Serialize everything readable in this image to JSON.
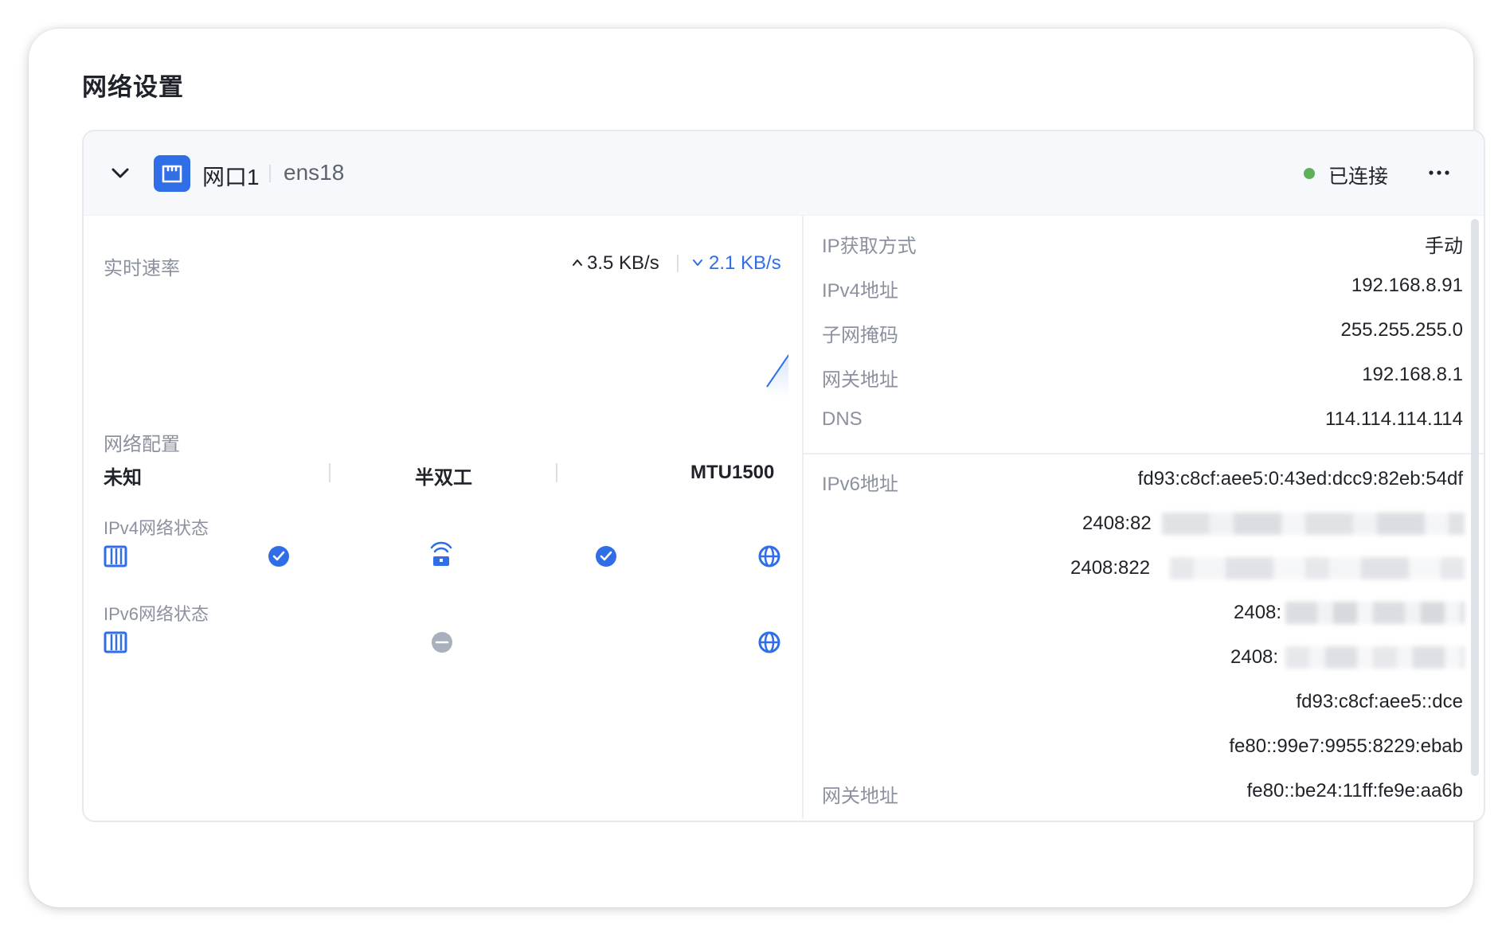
{
  "page": {
    "title": "网络设置"
  },
  "interface": {
    "name": "网口1",
    "device": "ens18",
    "status": "已连接",
    "status_color": "#5fb05a",
    "accent_color": "#2f6ee6"
  },
  "speed": {
    "label": "实时速率",
    "upload": "3.5 KB/s",
    "download": "2.1 KB/s"
  },
  "config": {
    "label": "网络配置",
    "duplex_speed": "未知",
    "duplex": "半双工",
    "mtu": "MTU1500"
  },
  "ipv4_status": {
    "label": "IPv4网络状态",
    "link_ok": true,
    "internet_ok": true
  },
  "ipv6_status": {
    "label": "IPv6网络状态",
    "state": "unknown"
  },
  "details": {
    "ip_method_label": "IP获取方式",
    "ip_method_value": "手动",
    "ipv4_label": "IPv4地址",
    "ipv4_value": "192.168.8.91",
    "mask_label": "子网掩码",
    "mask_value": "255.255.255.0",
    "gateway_label": "网关地址",
    "gateway_value": "192.168.8.1",
    "dns_label": "DNS",
    "dns_value": "114.114.114.114",
    "ipv6_label": "IPv6地址",
    "ipv6_values": [
      "fd93:c8cf:aee5:0:43ed:dcc9:82eb:54df",
      "2408:82",
      "2408:822",
      "2408:",
      "2408:",
      "fd93:c8cf:aee5::dce",
      "fe80::99e7:9955:8229:ebab"
    ],
    "ipv6_gateway_label": "网关地址",
    "ipv6_gateway_value": "fe80::be24:11ff:fe9e:aa6b"
  },
  "icons": {
    "collapse": "chevron-down-icon",
    "port": "ethernet-port-icon",
    "more": "more-horizontal-icon",
    "nic": "nic-icon",
    "router": "router-icon",
    "internet": "globe-icon",
    "ok": "check-circle-icon",
    "unknown": "minus-circle-icon"
  }
}
